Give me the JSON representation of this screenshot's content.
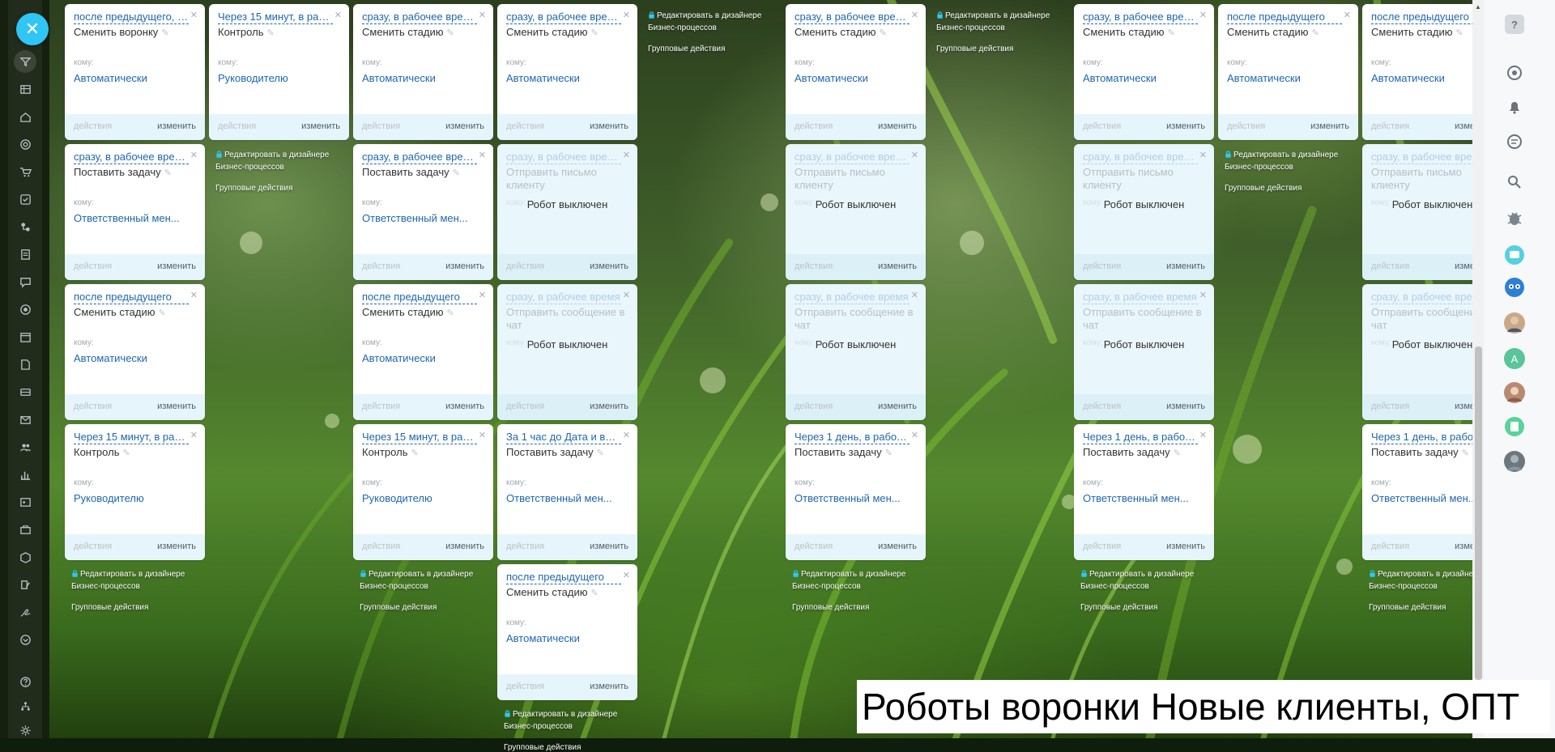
{
  "caption": "Роботы воронки Новые клиенты, ОПТ",
  "common": {
    "to_label": "кому:",
    "actions_label": "действия",
    "change_label": "изменить",
    "disabled_label": "Робот выключен",
    "designer_link": "Редактировать в дизайнере Бизнес-процессов",
    "group_actions": "Групповые действия"
  },
  "sidebar_left": {
    "close_label": "✕",
    "icons": [
      "filter-icon",
      "stages-icon",
      "home-icon",
      "target-icon",
      "cart-icon",
      "tasks-icon",
      "robots-icon",
      "document-icon",
      "chat-icon",
      "lifebuoy-icon",
      "calendar-icon",
      "file-icon",
      "storage-icon",
      "mail-icon",
      "contacts-icon",
      "analytics-icon",
      "contact-center-icon",
      "sales-icon",
      "shop-icon",
      "settings-edit-icon",
      "sign-icon",
      "more-icon",
      "help-icon",
      "structure-icon",
      "gear-icon"
    ]
  },
  "sidebar_right": {
    "items": [
      "help-icon",
      "pulse-icon",
      "bell-icon",
      "messages-icon",
      "search-icon",
      "bug-icon",
      "chat-bubble-icon",
      "owl-icon",
      "avatar-man",
      "avatar-a",
      "avatar-woman",
      "notes-icon",
      "avatar-gray"
    ],
    "avatar_letter": "A"
  },
  "cards": [
    {
      "delay": "после предыдущего, п...",
      "title": "Сменить воронку",
      "to": "Автоматически",
      "disabled": false
    },
    {
      "delay": "Через 15 минут, в раб...",
      "title": "Контроль",
      "to": "Руководителю",
      "disabled": false
    },
    {
      "delay": "сразу, в рабочее врем...",
      "title": "Сменить стадию",
      "to": "Автоматически",
      "disabled": false
    },
    {
      "delay": "сразу, в рабочее врем...",
      "title": "Сменить стадию",
      "to": "Автоматически",
      "disabled": false
    },
    {
      "delay": "сразу, в рабочее врем...",
      "title": "Сменить стадию",
      "to": "Автоматически",
      "disabled": false
    },
    {
      "delay": "сразу, в рабочее врем...",
      "title": "Сменить стадию",
      "to": "Автоматически",
      "disabled": false
    },
    {
      "delay": "после предыдущего",
      "title": "Сменить стадию",
      "to": "Автоматически",
      "disabled": false
    },
    {
      "delay": "после предыдущего",
      "title": "Сменить стадию",
      "to": "Автоматически",
      "disabled": false
    },
    {
      "delay": "сразу, в рабочее врем...",
      "title": "Поставить задачу",
      "to": "Ответственный мен...",
      "disabled": false
    },
    {
      "delay": "сразу, в рабочее врем...",
      "title": "Поставить задачу",
      "to": "Ответственный мен...",
      "disabled": false
    },
    {
      "delay": "сразу, в рабочее врем...",
      "title": "Отправить письмо клиенту",
      "to": "",
      "disabled": true
    },
    {
      "delay": "сразу, в рабочее врем...",
      "title": "Отправить письмо клиенту",
      "to": "",
      "disabled": true
    },
    {
      "delay": "сразу, в рабочее врем...",
      "title": "Отправить письмо клиенту",
      "to": "",
      "disabled": true
    },
    {
      "delay": "сразу, в рабочее врем...",
      "title": "Отправить письмо клиенту",
      "to": "",
      "disabled": true
    },
    {
      "delay": "после предыдущего",
      "title": "Сменить стадию",
      "to": "Автоматически",
      "disabled": false
    },
    {
      "delay": "после предыдущего",
      "title": "Сменить стадию",
      "to": "Автоматически",
      "disabled": false
    },
    {
      "delay": "сразу, в рабочее время",
      "title": "Отправить сообщение в чат",
      "to": "",
      "disabled": true
    },
    {
      "delay": "сразу, в рабочее время",
      "title": "Отправить сообщение в чат",
      "to": "",
      "disabled": true
    },
    {
      "delay": "сразу, в рабочее время",
      "title": "Отправить сообщение в чат",
      "to": "",
      "disabled": true
    },
    {
      "delay": "сразу, в рабочее время",
      "title": "Отправить сообщение в чат",
      "to": "",
      "disabled": true
    },
    {
      "delay": "Через 15 минут, в раб...",
      "title": "Контроль",
      "to": "Руководителю",
      "disabled": false
    },
    {
      "delay": "Через 15 минут, в раб...",
      "title": "Контроль",
      "to": "Руководителю",
      "disabled": false
    },
    {
      "delay": "За 1 час до Дата и вре...",
      "title": "Поставить задачу",
      "to": "Ответственный мен...",
      "disabled": false
    },
    {
      "delay": "Через 1 день, в рабоч...",
      "title": "Поставить задачу",
      "to": "Ответственный мен...",
      "disabled": false
    },
    {
      "delay": "Через 1 день, в рабоч...",
      "title": "Поставить задачу",
      "to": "Ответственный мен...",
      "disabled": false
    },
    {
      "delay": "Через 1 день, в рабоч...",
      "title": "Поставить задачу",
      "to": "Ответственный мен...",
      "disabled": false
    },
    {
      "delay": "после предыдущего",
      "title": "Сменить стадию",
      "to": "Автоматически",
      "disabled": false
    }
  ]
}
